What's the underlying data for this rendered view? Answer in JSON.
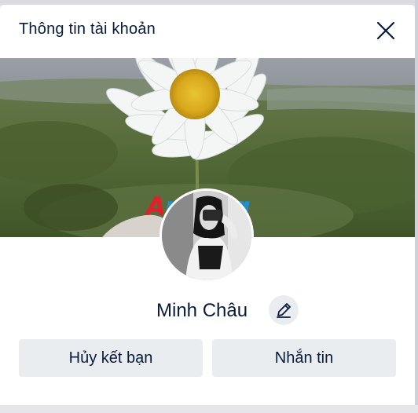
{
  "dialog": {
    "title": "Thông tin tài khoản",
    "close_icon": "close-icon"
  },
  "cover": {
    "description_icon": "cover-photo"
  },
  "watermark": {
    "text": "Aphang"
  },
  "profile": {
    "name": "Minh Châu",
    "edit_icon": "pencil-icon"
  },
  "actions": {
    "unfriend_label": "Hủy kết bạn",
    "message_label": "Nhắn tin"
  },
  "colors": {
    "title_text": "#081b3a",
    "button_bg": "#eaedf0",
    "watermark_red": "#e0212b",
    "watermark_blue": "#1f8fd6"
  }
}
